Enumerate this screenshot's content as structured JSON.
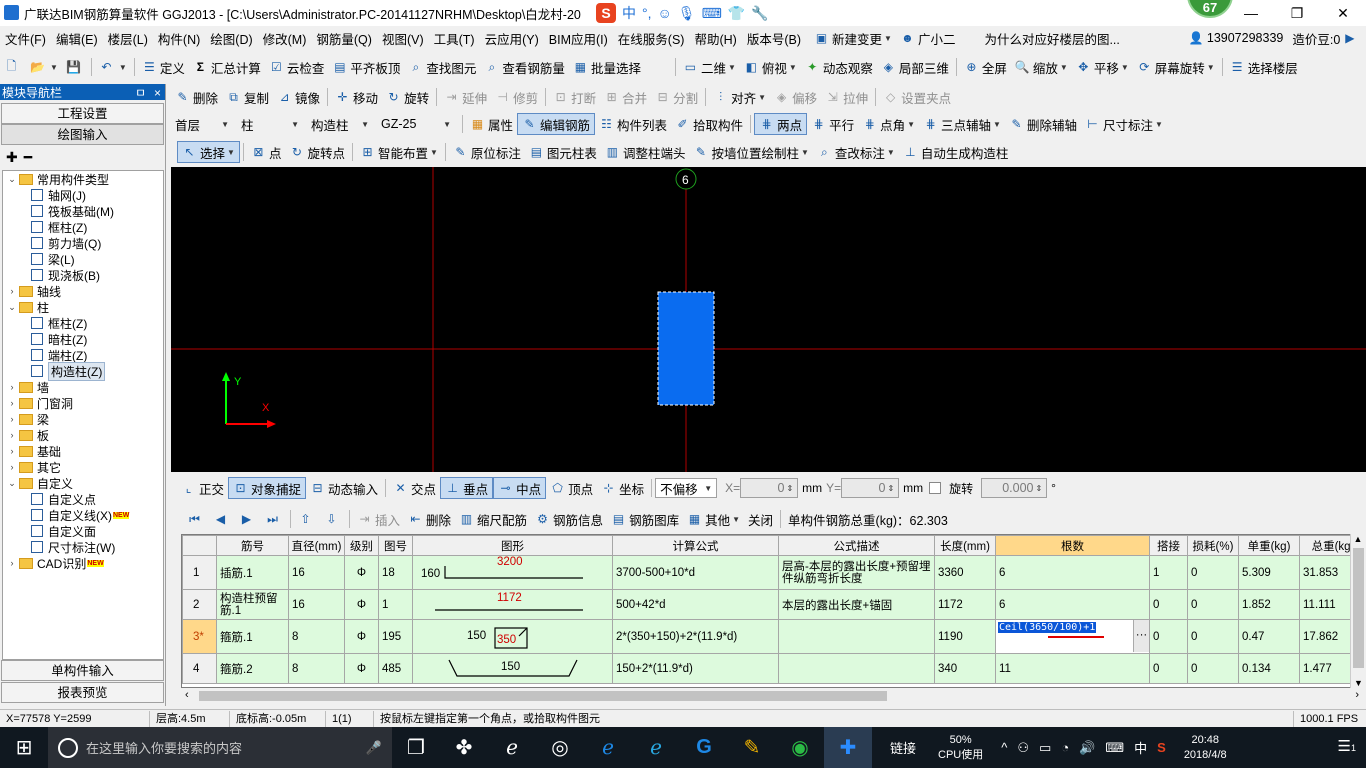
{
  "window": {
    "title": "广联达BIM钢筋算量软件 GGJ2013 - [C:\\Users\\Administrator.PC-20141127NRHM\\Desktop\\白龙村-20",
    "ime": {
      "label": "中",
      "punct": "°,"
    },
    "badge": "67"
  },
  "menu": {
    "items": [
      "文件(F)",
      "编辑(E)",
      "楼层(L)",
      "构件(N)",
      "绘图(D)",
      "修改(M)",
      "钢筋量(Q)",
      "视图(V)",
      "工具(T)",
      "云应用(Y)",
      "BIM应用(I)",
      "在线服务(S)",
      "帮助(H)",
      "版本号(B)"
    ],
    "new_change": "新建变更",
    "assistant": "广小二",
    "question": "为什么对应好楼层的图...",
    "phone": "13907298339",
    "bean": "造价豆:0"
  },
  "toolbar1": {
    "define": "定义",
    "sum_calc": "汇总计算",
    "cloud_check": "云检查",
    "level_slab": "平齐板顶",
    "find_element": "查找图元",
    "view_rebar": "查看钢筋量",
    "batch_select": "批量选择",
    "view_2d": "二维",
    "top_view": "俯视",
    "dynamic_view": "动态观察",
    "local_3d": "局部三维",
    "full_screen": "全屏",
    "zoom": "缩放",
    "pan": "平移",
    "rotate_screen": "屏幕旋转",
    "select_floor": "选择楼层"
  },
  "toolbar2": {
    "panel_title": "模块导航栏",
    "pin": "ㅁ",
    "close": "×",
    "delete": "删除",
    "copy": "复制",
    "mirror": "镜像",
    "move": "移动",
    "rotate": "旋转",
    "extend": "延伸",
    "trim": "修剪",
    "break": "打断",
    "merge": "合并",
    "split": "分割",
    "align": "对齐",
    "offset": "偏移",
    "stretch": "拉伸",
    "set_grip": "设置夹点"
  },
  "toolbar3": {
    "floor": "首层",
    "type": "柱",
    "subtype": "构造柱",
    "name": "GZ-25",
    "attributes": "属性",
    "edit_rebar": "编辑钢筋",
    "element_list": "构件列表",
    "pick_element": "拾取构件",
    "two_points": "两点",
    "parallel": "平行",
    "point_angle": "点角",
    "three_point_aux": "三点辅轴",
    "delete_aux": "删除辅轴",
    "dimension": "尺寸标注"
  },
  "toolbar4": {
    "select": "选择",
    "point": "点",
    "rotate_point": "旋转点",
    "smart_layout": "智能布置",
    "in_place_label": "原位标注",
    "column_table": "图元柱表",
    "adjust_column_end": "调整柱端头",
    "draw_by_wall": "按墙位置绘制柱",
    "change_label": "查改标注",
    "auto_gen_column": "自动生成构造柱"
  },
  "nav": {
    "project_settings": "工程设置",
    "drawing_input": "绘图输入",
    "single_input": "单构件输入",
    "report_preview": "报表预览",
    "tree": [
      {
        "label": "常用构件类型",
        "level": 0,
        "exp": "⌄",
        "kind": "folder"
      },
      {
        "label": "轴网(J)",
        "level": 1,
        "kind": "leaf",
        "icon": "grid-icon"
      },
      {
        "label": "筏板基础(M)",
        "level": 1,
        "kind": "leaf",
        "icon": "raft-icon"
      },
      {
        "label": "框柱(Z)",
        "level": 1,
        "kind": "leaf",
        "icon": "column-icon"
      },
      {
        "label": "剪力墙(Q)",
        "level": 1,
        "kind": "leaf",
        "icon": "wall-icon"
      },
      {
        "label": "梁(L)",
        "level": 1,
        "kind": "leaf",
        "icon": "beam-icon"
      },
      {
        "label": "现浇板(B)",
        "level": 1,
        "kind": "leaf",
        "icon": "slab-icon"
      },
      {
        "label": "轴线",
        "level": 0,
        "exp": "›",
        "kind": "folder"
      },
      {
        "label": "柱",
        "level": 0,
        "exp": "⌄",
        "kind": "folder"
      },
      {
        "label": "框柱(Z)",
        "level": 1,
        "kind": "leaf",
        "icon": "column-icon"
      },
      {
        "label": "暗柱(Z)",
        "level": 1,
        "kind": "leaf",
        "icon": "column-icon"
      },
      {
        "label": "端柱(Z)",
        "level": 1,
        "kind": "leaf",
        "icon": "column-icon"
      },
      {
        "label": "构造柱(Z)",
        "level": 1,
        "kind": "leaf",
        "icon": "constructional-column-icon",
        "selected": true
      },
      {
        "label": "墙",
        "level": 0,
        "exp": "›",
        "kind": "folder"
      },
      {
        "label": "门窗洞",
        "level": 0,
        "exp": "›",
        "kind": "folder"
      },
      {
        "label": "梁",
        "level": 0,
        "exp": "›",
        "kind": "folder"
      },
      {
        "label": "板",
        "level": 0,
        "exp": "›",
        "kind": "folder"
      },
      {
        "label": "基础",
        "level": 0,
        "exp": "›",
        "kind": "folder"
      },
      {
        "label": "其它",
        "level": 0,
        "exp": "›",
        "kind": "folder"
      },
      {
        "label": "自定义",
        "level": 0,
        "exp": "⌄",
        "kind": "folder"
      },
      {
        "label": "自定义点",
        "level": 1,
        "kind": "leaf",
        "icon": "custom-point-icon"
      },
      {
        "label": "自定义线(X)",
        "level": 1,
        "kind": "leaf",
        "icon": "custom-line-icon",
        "new": true
      },
      {
        "label": "自定义面",
        "level": 1,
        "kind": "leaf",
        "icon": "custom-face-icon"
      },
      {
        "label": "尺寸标注(W)",
        "level": 1,
        "kind": "leaf",
        "icon": "dimension-icon"
      },
      {
        "label": "CAD识别",
        "level": 0,
        "exp": "›",
        "kind": "folder",
        "new": true
      }
    ],
    "new_badge": "NEW"
  },
  "canvas": {
    "axis_label": "6",
    "y_label": "Y",
    "x_label": "X",
    "colors": {
      "bg": "#000000",
      "axis": "#c00000",
      "column": "#0a6cf0"
    }
  },
  "snap": {
    "ortho": "正交",
    "object_snap": "对象捕捉",
    "dynamic_input": "动态输入",
    "intersection": "交点",
    "perpendicular": "垂点",
    "midpoint": "中点",
    "vertex": "顶点",
    "coordinate": "坐标",
    "offset_mode": "不偏移",
    "x_label": "X=",
    "x_value": "0",
    "mm1": "mm",
    "y_label": "Y=",
    "y_value": "0",
    "mm2": "mm",
    "rotate_label": "旋转",
    "rotate_value": "0.000",
    "deg": "°"
  },
  "gridtool": {
    "insert": "插入",
    "delete": "删除",
    "scale_rebar": "缩尺配筋",
    "rebar_info": "钢筋信息",
    "rebar_library": "钢筋图库",
    "other": "其他",
    "close": "关闭",
    "total_label": "单构件钢筋总重(kg)：62.303"
  },
  "table": {
    "headers": [
      "",
      "筋号",
      "直径(mm)",
      "级别",
      "图号",
      "图形",
      "计算公式",
      "公式描述",
      "长度(mm)",
      "根数",
      "搭接",
      "损耗(%)",
      "单重(kg)",
      "总重(kg)"
    ],
    "rows": [
      {
        "no": "1",
        "name": "插筋.1",
        "dia": "16",
        "grade": "Φ",
        "fig": "18",
        "shape_left": "160",
        "shape_top": "3200",
        "formula": "3700-500+10*d",
        "desc": "层高-本层的露出长度+预留埋件纵筋弯折长度",
        "length": "3360",
        "count": "6",
        "lap": "1",
        "loss": "0",
        "unit_w": "5.309",
        "total_w": "31.853"
      },
      {
        "no": "2",
        "name": "构造柱预留筋.1",
        "dia": "16",
        "grade": "Φ",
        "fig": "1",
        "shape_top": "1172",
        "formula": "500+42*d",
        "desc": "本层的露出长度+锚固",
        "length": "1172",
        "count": "6",
        "lap": "0",
        "loss": "0",
        "unit_w": "1.852",
        "total_w": "11.111"
      },
      {
        "no": "3*",
        "name": "箍筋.1",
        "dia": "8",
        "grade": "Φ",
        "fig": "195",
        "shape_left": "150",
        "shape_top": "350",
        "formula": "2*(350+150)+2*(11.9*d)",
        "desc": "",
        "length": "1190",
        "count": "Ceil(3650/100)+1",
        "lap": "0",
        "loss": "0",
        "unit_w": "0.47",
        "total_w": "17.862"
      },
      {
        "no": "4",
        "name": "箍筋.2",
        "dia": "8",
        "grade": "Φ",
        "fig": "485",
        "shape_top": "150",
        "formula": "150+2*(11.9*d)",
        "desc": "",
        "length": "340",
        "count": "11",
        "lap": "0",
        "loss": "0",
        "unit_w": "0.134",
        "total_w": "1.477"
      }
    ],
    "edit_button": "···"
  },
  "status": {
    "coords": "X=77578 Y=2599",
    "floor_height": "层高:4.5m",
    "bottom_elev": "底标高:-0.05m",
    "count": "1(1)",
    "hint": "按鼠标左键指定第一个角点，或拾取构件图元",
    "fps": "1000.1 FPS"
  },
  "taskbar": {
    "search_placeholder": "在这里输入你要搜索的内容",
    "link": "链接",
    "cpu_percent": "50%",
    "cpu_label": "CPU使用",
    "lang": "中",
    "time": "20:48",
    "date": "2018/4/8",
    "notify_count": "1"
  }
}
